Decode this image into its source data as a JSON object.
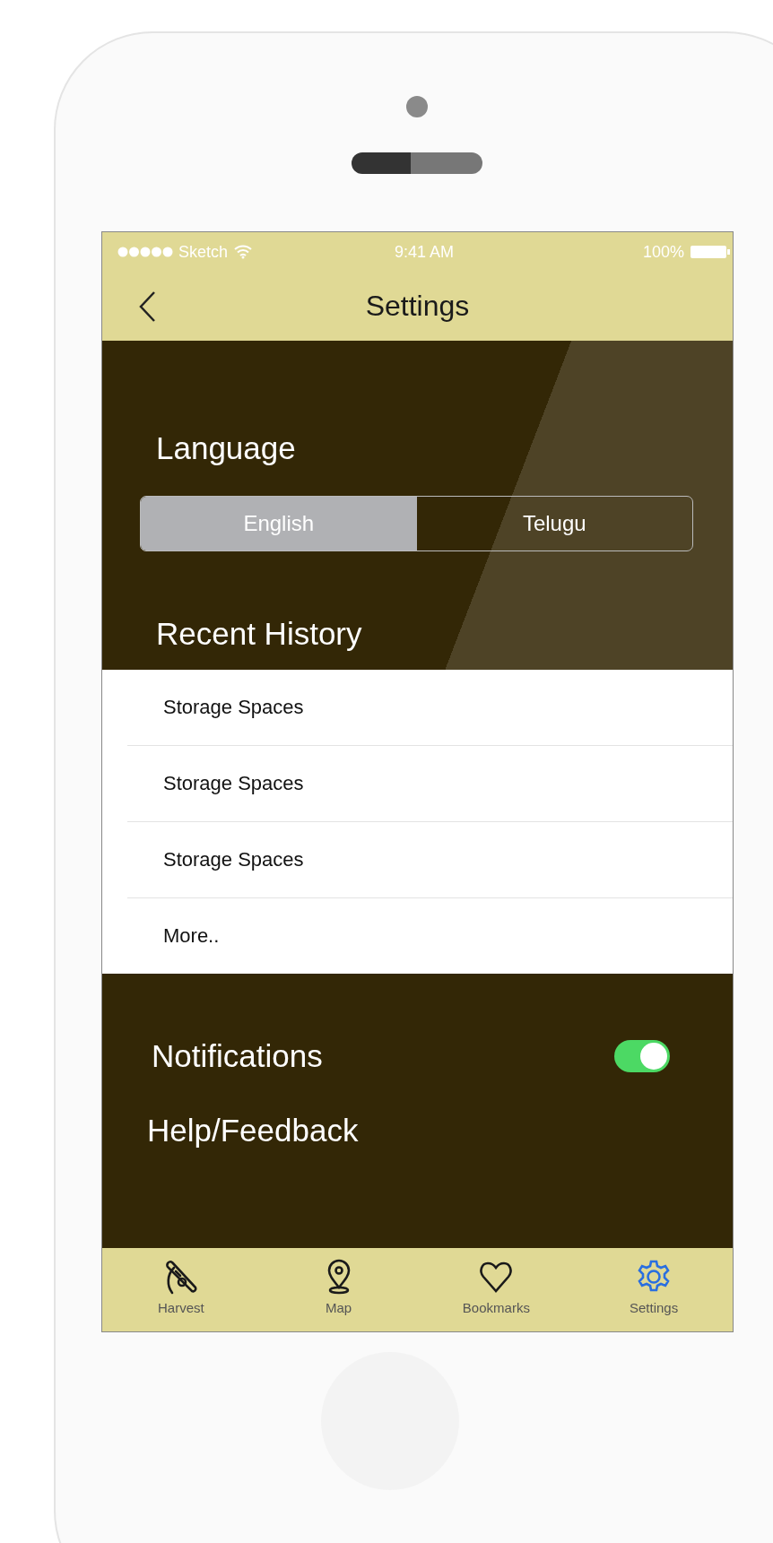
{
  "status_bar": {
    "carrier": "Sketch",
    "time": "9:41 AM",
    "battery": "100%"
  },
  "nav_bar": {
    "title": "Settings"
  },
  "language": {
    "label": "Language",
    "options": [
      {
        "label": "English",
        "selected": true
      },
      {
        "label": "Telugu",
        "selected": false
      }
    ]
  },
  "recent_history": {
    "title": "Recent History",
    "items": [
      {
        "label": "Storage Spaces"
      },
      {
        "label": "Storage Spaces"
      },
      {
        "label": "Storage Spaces"
      },
      {
        "label": "More.."
      }
    ]
  },
  "notifications": {
    "label": "Notifications",
    "on": true
  },
  "help": {
    "label": "Help/Feedback"
  },
  "tab_bar": [
    {
      "kind": "harvest",
      "label": "Harvest",
      "selected": false
    },
    {
      "kind": "map",
      "label": "Map",
      "selected": false
    },
    {
      "kind": "bookmarks",
      "label": "Bookmarks",
      "selected": false
    },
    {
      "kind": "settings",
      "label": "Settings",
      "selected": true
    }
  ]
}
